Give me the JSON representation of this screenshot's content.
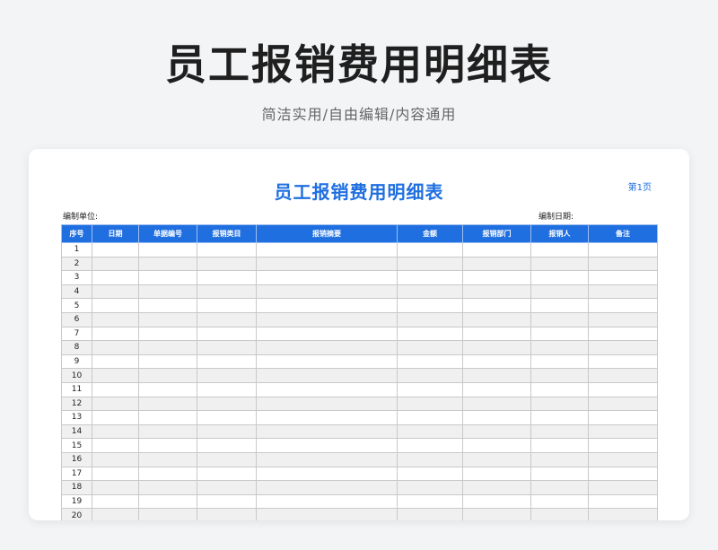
{
  "hero": {
    "title": "员工报销费用明细表",
    "subtitle": "简洁实用/自由编辑/内容通用"
  },
  "sheet": {
    "title": "员工报销费用明细表",
    "page_label": "第1页",
    "unit_label": "编制单位:",
    "date_label": "编制日期:",
    "columns": [
      "序号",
      "日期",
      "单据编号",
      "报销类目",
      "报销摘要",
      "金额",
      "报销部门",
      "报销人",
      "备注"
    ],
    "row_numbers": [
      "1",
      "2",
      "3",
      "4",
      "5",
      "6",
      "7",
      "8",
      "9",
      "10",
      "11",
      "12",
      "13",
      "14",
      "15",
      "16",
      "17",
      "18",
      "19",
      "20"
    ]
  },
  "colors": {
    "accent": "#1f6fe0",
    "header_text": "#ffffff",
    "page_bg": "#f3f4f6"
  }
}
